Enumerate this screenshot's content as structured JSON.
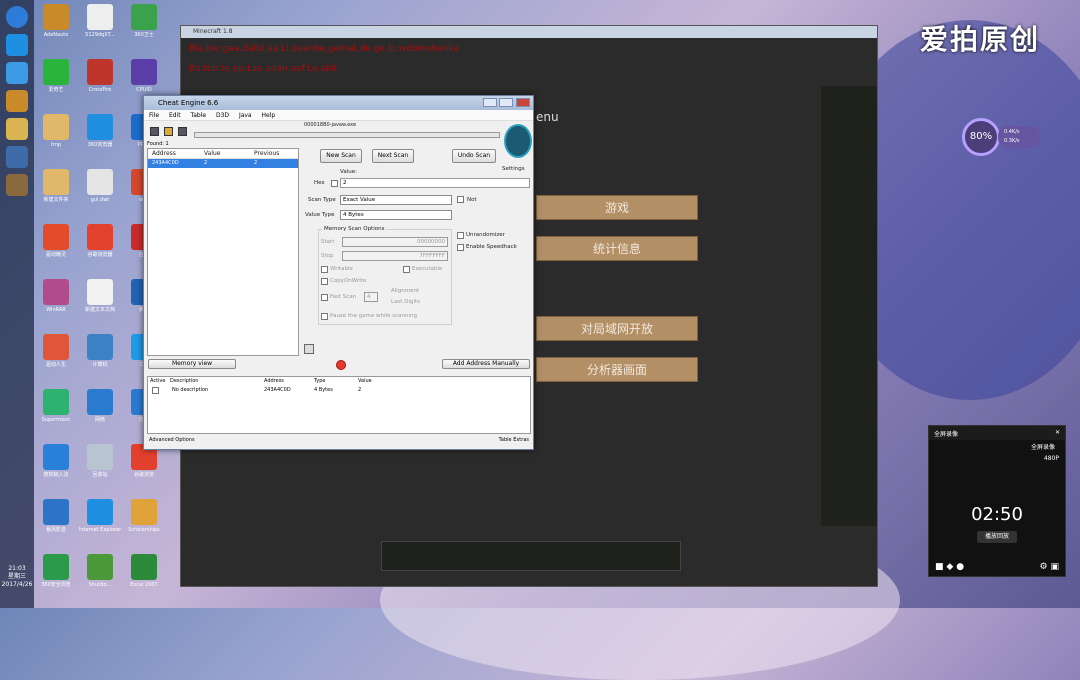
{
  "desktop": {
    "icons": [
      {
        "label": "AdeNauto",
        "col": 0,
        "row": 0,
        "color": "#c98a2a"
      },
      {
        "label": "5129dqXT...",
        "col": 1,
        "row": 0,
        "color": "#eeeeee"
      },
      {
        "label": "360卫士",
        "col": 2,
        "row": 0,
        "color": "#3aa24a"
      },
      {
        "label": "爱奇艺",
        "col": 0,
        "row": 1,
        "color": "#2ab43c"
      },
      {
        "label": "CrossFire",
        "col": 1,
        "row": 1,
        "color": "#c0352b"
      },
      {
        "label": "CPUID",
        "col": 2,
        "row": 1,
        "color": "#5b3ea8"
      },
      {
        "label": "tmp",
        "col": 0,
        "row": 2,
        "color": "#e1b86a"
      },
      {
        "label": "360浏览器",
        "col": 1,
        "row": 2,
        "color": "#1e8fe1"
      },
      {
        "label": "PPTV",
        "col": 2,
        "row": 2,
        "color": "#1c6cc9"
      },
      {
        "label": "新建文件夹",
        "col": 0,
        "row": 3,
        "color": "#e1b86a"
      },
      {
        "label": "gul.dwt",
        "col": 1,
        "row": 3,
        "color": "#e5e5e5"
      },
      {
        "label": "wps",
        "col": 2,
        "row": 3,
        "color": "#d6472c"
      },
      {
        "label": "驱动精灵",
        "col": 0,
        "row": 4,
        "color": "#e34c2a"
      },
      {
        "label": "谷歌浏览器",
        "col": 1,
        "row": 4,
        "color": "#e4402e"
      },
      {
        "label": "应用",
        "col": 2,
        "row": 4,
        "color": "#c82b2b"
      },
      {
        "label": "WinRAR",
        "col": 0,
        "row": 5,
        "color": "#b24b8c"
      },
      {
        "label": "新建文本文档",
        "col": 1,
        "row": 5,
        "color": "#f1f1f1"
      },
      {
        "label": "腾讯",
        "col": 2,
        "row": 5,
        "color": "#2263b5"
      },
      {
        "label": "驱动人生",
        "col": 0,
        "row": 6,
        "color": "#e0563a"
      },
      {
        "label": "计算机",
        "col": 1,
        "row": 6,
        "color": "#3b82c5"
      },
      {
        "label": "QQ",
        "col": 2,
        "row": 6,
        "color": "#1e9ae6"
      },
      {
        "label": "Supermoon",
        "col": 0,
        "row": 7,
        "color": "#2db36f"
      },
      {
        "label": "网络",
        "col": 1,
        "row": 7,
        "color": "#2a7bd0"
      },
      {
        "label": "控制",
        "col": 2,
        "row": 7,
        "color": "#2a7bd0"
      },
      {
        "label": "搜狗输入法",
        "col": 0,
        "row": 8,
        "color": "#2a80d8"
      },
      {
        "label": "回收站",
        "col": 1,
        "row": 8,
        "color": "#b9c4d1"
      },
      {
        "label": "谷歌浏览",
        "col": 2,
        "row": 8,
        "color": "#e4402e"
      },
      {
        "label": "暴风影音",
        "col": 0,
        "row": 9,
        "color": "#2d73c8"
      },
      {
        "label": "Internet Explorer",
        "col": 1,
        "row": 9,
        "color": "#1e8fe1"
      },
      {
        "label": "Scholarships",
        "col": 2,
        "row": 9,
        "color": "#e0a33a"
      },
      {
        "label": "360安全浏览",
        "col": 0,
        "row": 10,
        "color": "#2c9a4b"
      },
      {
        "label": "Shutdo...",
        "col": 1,
        "row": 10,
        "color": "#4b9a3a"
      },
      {
        "label": "Excel 2007",
        "col": 2,
        "row": 10,
        "color": "#2c8a3b"
      }
    ],
    "taskbar_clock_time": "21:03",
    "taskbar_clock_day": "星期三",
    "taskbar_clock_date": "2017/4/26"
  },
  "watermark": {
    "text": "爱拍原创"
  },
  "perf_widget": {
    "value": "80%",
    "line1": "0.4K/s",
    "line2": "0.3K/s"
  },
  "recorder": {
    "title": "全屏录像",
    "mode": "全屏录像",
    "resolution": "480P",
    "time": "02:50",
    "button": "播放回放"
  },
  "game": {
    "title": "Minecraft 1.8",
    "red_lines": [
      "Bla.ble.gaa.dalbi.aa.Ll.deanbe.gamat.de.ge.lo.wdomebenka",
      "Bo.tob.te.pp.Lse.adan.aof.Lo.abit"
    ],
    "menu_text": "enu",
    "buttons": [
      "游戏",
      "统计信息",
      "对局域网开放",
      "分析器画面"
    ]
  },
  "cheat_engine": {
    "title": "Cheat Engine 6.6",
    "menu": [
      "File",
      "Edit",
      "Table",
      "D3D",
      "Java",
      "Help"
    ],
    "process": "000018B0-javaw.exe",
    "found": "Found: 1",
    "results_headers": [
      "Address",
      "Value",
      "Previous"
    ],
    "results_rows": [
      {
        "address": "243A4C0D",
        "value": "2",
        "previous": "2"
      }
    ],
    "buttons": {
      "new_scan": "New Scan",
      "next_scan": "Next Scan",
      "undo_scan": "Undo Scan",
      "memory_view": "Memory view",
      "add_manual": "Add Address Manually"
    },
    "settings_label": "Settings",
    "value_label": "Value:",
    "hex_label": "Hex",
    "value_input": "2",
    "scan_type_label": "Scan Type",
    "scan_type_value": "Exact Value",
    "value_type_label": "Value Type",
    "value_type_value": "4 Bytes",
    "not_label": "Not",
    "mem_opts_label": "Memory Scan Options",
    "start_label": "Start",
    "start_value": "00000000",
    "stop_label": "Stop",
    "stop_value": "7FFFFFFF",
    "writable": "Writable",
    "executable": "Executable",
    "copyonwrite": "CopyOnWrite",
    "fastscan": "Fast Scan",
    "fastscan_value": "4",
    "alignment": "Alignment",
    "lastdigits": "Last Digits",
    "pause": "Pause the game while scanning",
    "unrandomizer": "Unrandomizer",
    "speedhack": "Enable Speedhack",
    "table_headers": [
      "Active",
      "Description",
      "Address",
      "Type",
      "Value"
    ],
    "table_rows": [
      {
        "description": "No description",
        "address": "243A4C0D",
        "type": "4 Bytes",
        "value": "2"
      }
    ],
    "adv_options": "Advanced Options",
    "table_extras": "Table Extras"
  }
}
